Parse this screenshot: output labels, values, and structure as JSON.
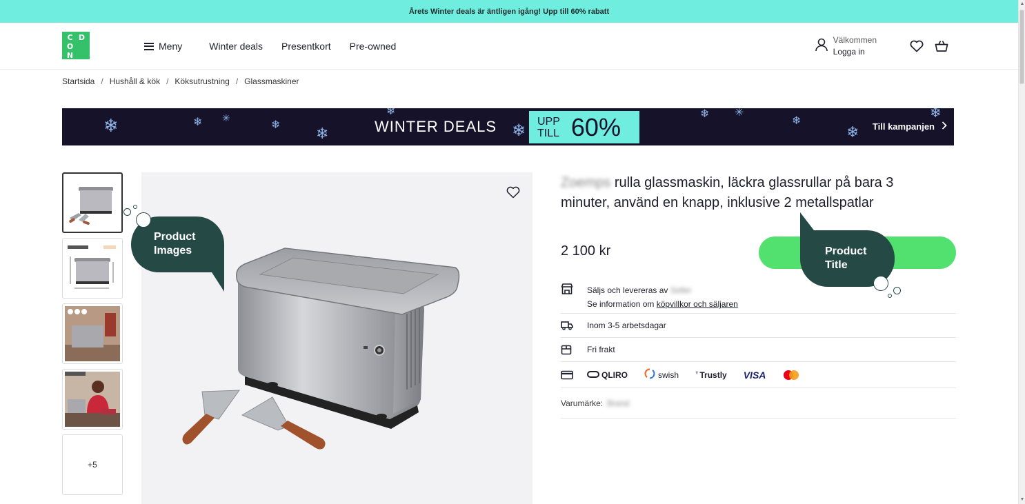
{
  "promo": {
    "text": "Årets Winter deals är äntligen igång! Upp till 60% rabatt"
  },
  "logo": {
    "letters": [
      "C",
      "D",
      "O",
      "N"
    ]
  },
  "nav": {
    "menu": "Meny",
    "items": [
      "Winter deals",
      "Presentkort",
      "Pre-owned"
    ]
  },
  "user": {
    "welcome": "Välkommen",
    "login": "Logga in"
  },
  "breadcrumb": [
    "Startsida",
    "Hushåll & kök",
    "Köksutrustning",
    "Glassmaskiner"
  ],
  "banner": {
    "title": "WINTER DEALS",
    "upp": "UPP",
    "till": "TILL",
    "percent": "60%",
    "cta": "Till kampanjen"
  },
  "thumbnails": {
    "more": "+5"
  },
  "callouts": {
    "images": [
      "Product",
      "Images"
    ],
    "title": [
      "Product",
      "Title"
    ]
  },
  "product": {
    "brand": "Zoemps",
    "title": "rulla glassmaskin, läckra glassrullar på bara 3 minuter, använd en knapp, inklusive 2 metallspatlar",
    "price": "2 100 kr"
  },
  "info": {
    "sold_by": "Säljs och levereras av",
    "seller": "Seller",
    "see_info": "Se information om",
    "terms_link": "köpvillkor och säljaren",
    "delivery": "Inom 3-5 arbetsdagar",
    "shipping": "Fri frakt",
    "payments": [
      "QLIRO",
      "swish",
      "Trustly",
      "VISA"
    ],
    "brand_label": "Varumärke:",
    "brand_value": "Brand"
  },
  "colors": {
    "accent": "#6fedde",
    "brand_green": "#35c16a",
    "buy": "#52e06e",
    "callout": "#254a46",
    "banner_bg": "#15122a"
  }
}
